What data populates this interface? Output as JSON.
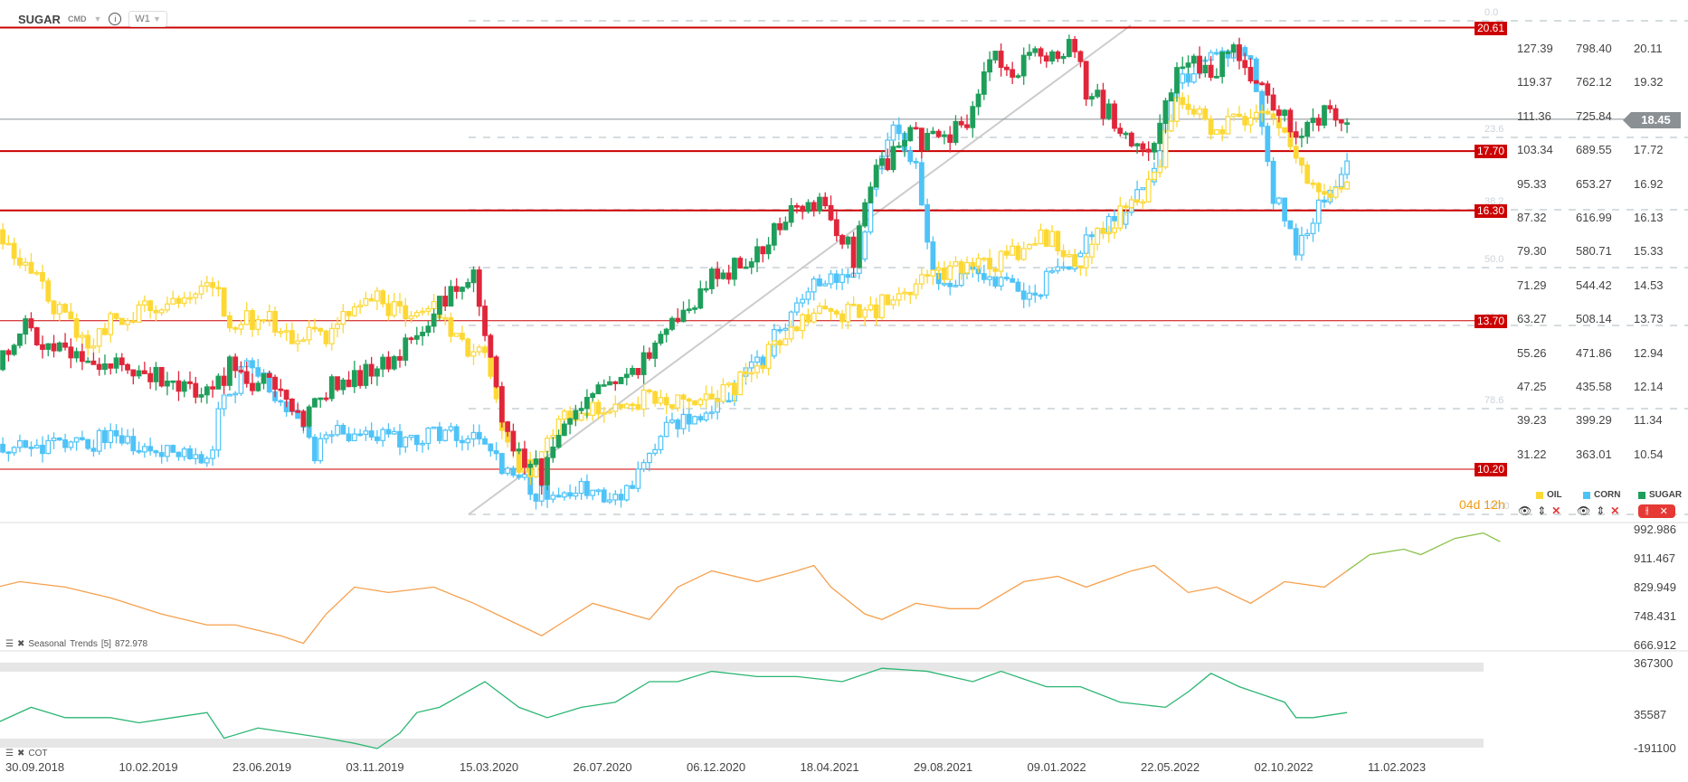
{
  "header": {
    "symbol": "SUGAR",
    "market": "CMD",
    "timeframe": "W1"
  },
  "current_price": "18.45",
  "countdown": "04d 12h",
  "axes": {
    "oil": [
      "127.39",
      "119.37",
      "111.36",
      "103.34",
      "95.33",
      "87.32",
      "79.30",
      "71.29",
      "63.27",
      "55.26",
      "47.25",
      "39.23",
      "31.22"
    ],
    "corn": [
      "798.40",
      "762.12",
      "725.84",
      "689.55",
      "653.27",
      "616.99",
      "580.71",
      "544.42",
      "508.14",
      "471.86",
      "435.58",
      "399.29",
      "363.01"
    ],
    "sugar": [
      "20.11",
      "19.32",
      "18.52",
      "17.72",
      "16.92",
      "16.13",
      "15.33",
      "14.53",
      "13.73",
      "12.94",
      "12.14",
      "11.34",
      "10.54"
    ],
    "seasonal": [
      "992.986",
      "911.467",
      "829.949",
      "748.431",
      "666.912"
    ],
    "cot": [
      "367300",
      "35587",
      "-191100"
    ]
  },
  "hlines": [
    "20.61",
    "17.70",
    "16.30",
    "13.70",
    "10.20"
  ],
  "fib": [
    "0.0",
    "23.6",
    "38.2",
    "50.0",
    "61.8",
    "78.6",
    "100.0"
  ],
  "legend": [
    {
      "name": "OIL",
      "color": "#fdd835"
    },
    {
      "name": "CORN",
      "color": "#4fc3f7"
    },
    {
      "name": "SUGAR",
      "color": "#1e9e5a"
    }
  ],
  "panels": {
    "seasonal_label": "Seasonal",
    "seasonal_name": "Trends",
    "seasonal_period": "[5]",
    "seasonal_value": "872.978",
    "cot_label": "COT"
  },
  "dates": [
    "30.09.2018",
    "10.02.2019",
    "23.06.2019",
    "03.11.2019",
    "15.03.2020",
    "26.07.2020",
    "06.12.2020",
    "18.04.2021",
    "29.08.2021",
    "09.01.2022",
    "22.05.2022",
    "02.10.2022",
    "11.02.2023"
  ],
  "chart_data": {
    "type": "candlestick",
    "title": "SUGAR W1 with OIL and CORN overlay",
    "x_unit": "weeks since 30.09.2018",
    "series": [
      {
        "name": "SUGAR",
        "axis": "sugar",
        "anchors": [
          [
            -8,
            12.64
          ],
          [
            -4,
            13.65
          ],
          [
            4,
            12.9
          ],
          [
            12,
            12.6
          ],
          [
            21,
            12.4
          ],
          [
            29,
            11.9
          ],
          [
            33,
            12.6
          ],
          [
            40,
            12.1
          ],
          [
            46,
            11.25
          ],
          [
            50,
            12.1
          ],
          [
            57,
            12.5
          ],
          [
            65,
            13.1
          ],
          [
            70,
            14.1
          ],
          [
            76,
            14.7
          ],
          [
            79,
            12.9
          ],
          [
            81,
            11.4
          ],
          [
            84,
            10.4
          ],
          [
            88,
            10.1
          ],
          [
            93,
            11.6
          ],
          [
            101,
            12.1
          ],
          [
            107,
            12.9
          ],
          [
            112,
            13.65
          ],
          [
            118,
            14.7
          ],
          [
            126,
            15.2
          ],
          [
            131,
            16.2
          ],
          [
            137,
            16.4
          ],
          [
            143,
            15.2
          ],
          [
            146,
            17.0
          ],
          [
            152,
            18.0
          ],
          [
            158,
            18.0
          ],
          [
            164,
            18.5
          ],
          [
            167,
            20.0
          ],
          [
            171,
            19.5
          ],
          [
            175,
            20.0
          ],
          [
            181,
            20.2
          ],
          [
            184,
            19.2
          ],
          [
            190,
            18.2
          ],
          [
            196,
            17.7
          ],
          [
            200,
            19.7
          ],
          [
            203,
            19.7
          ],
          [
            207,
            19.7
          ],
          [
            211,
            20.0
          ],
          [
            217,
            18.7
          ],
          [
            222,
            18.0
          ],
          [
            226,
            18.5
          ],
          [
            230,
            18.45
          ]
        ]
      },
      {
        "name": "CORN",
        "axis": "corn",
        "anchors": [
          [
            -8,
            366
          ],
          [
            2,
            378
          ],
          [
            12,
            378
          ],
          [
            21,
            372
          ],
          [
            30,
            361
          ],
          [
            31,
            407
          ],
          [
            36,
            459
          ],
          [
            42,
            424
          ],
          [
            48,
            366
          ],
          [
            53,
            389
          ],
          [
            61,
            378
          ],
          [
            69,
            384
          ],
          [
            78,
            378
          ],
          [
            82,
            343
          ],
          [
            88,
            320
          ],
          [
            95,
            326
          ],
          [
            103,
            320
          ],
          [
            107,
            355
          ],
          [
            110,
            389
          ],
          [
            118,
            412
          ],
          [
            126,
            459
          ],
          [
            131,
            505
          ],
          [
            137,
            551
          ],
          [
            143,
            551
          ],
          [
            146,
            643
          ],
          [
            150,
            712
          ],
          [
            154,
            677
          ],
          [
            157,
            551
          ],
          [
            160,
            539
          ],
          [
            164,
            562
          ],
          [
            171,
            539
          ],
          [
            175,
            539
          ],
          [
            183,
            585
          ],
          [
            190,
            620
          ],
          [
            196,
            666
          ],
          [
            200,
            758
          ],
          [
            203,
            770
          ],
          [
            207,
            804
          ],
          [
            213,
            781
          ],
          [
            217,
            643
          ],
          [
            221,
            585
          ],
          [
            224,
            620
          ],
          [
            230,
            677
          ]
        ]
      },
      {
        "name": "OIL",
        "axis": "oil",
        "anchors": [
          [
            -8,
            84.1
          ],
          [
            -4,
            77.8
          ],
          [
            0,
            70.2
          ],
          [
            4,
            62.5
          ],
          [
            8,
            57.4
          ],
          [
            12,
            62.5
          ],
          [
            17,
            65.1
          ],
          [
            23,
            68.9
          ],
          [
            27,
            71.4
          ],
          [
            30,
            72.7
          ],
          [
            33,
            62.5
          ],
          [
            40,
            63.8
          ],
          [
            44,
            60
          ],
          [
            50,
            60
          ],
          [
            55,
            65.1
          ],
          [
            59,
            67.6
          ],
          [
            65,
            65.1
          ],
          [
            70,
            65.1
          ],
          [
            74,
            57.4
          ],
          [
            78,
            54.9
          ],
          [
            82,
            32
          ],
          [
            86,
            26.9
          ],
          [
            91,
            39.6
          ],
          [
            99,
            42.2
          ],
          [
            107,
            44.7
          ],
          [
            114,
            42.2
          ],
          [
            122,
            47.3
          ],
          [
            126,
            52.4
          ],
          [
            129,
            57.4
          ],
          [
            135,
            65.1
          ],
          [
            141,
            65.1
          ],
          [
            145,
            65.1
          ],
          [
            150,
            67.6
          ],
          [
            156,
            72.7
          ],
          [
            162,
            75.3
          ],
          [
            167,
            75.3
          ],
          [
            173,
            80.3
          ],
          [
            177,
            82.9
          ],
          [
            183,
            75.3
          ],
          [
            186,
            82.9
          ],
          [
            192,
            90.5
          ],
          [
            196,
            95.6
          ],
          [
            200,
            116
          ],
          [
            203,
            113.4
          ],
          [
            207,
            108.3
          ],
          [
            211,
            110.9
          ],
          [
            215,
            113.4
          ],
          [
            219,
            105.8
          ],
          [
            222,
            98.1
          ],
          [
            226,
            93
          ],
          [
            230,
            95.6
          ]
        ]
      }
    ],
    "seasonal": {
      "name": "Seasonal Trends [5]",
      "points": [
        [
          -8,
          834
        ],
        [
          -4,
          849
        ],
        [
          4,
          834
        ],
        [
          12,
          804
        ],
        [
          21,
          759
        ],
        [
          29,
          729
        ],
        [
          34,
          729
        ],
        [
          42,
          699
        ],
        [
          46,
          678
        ],
        [
          50,
          759
        ],
        [
          55,
          834
        ],
        [
          61,
          819
        ],
        [
          69,
          834
        ],
        [
          76,
          789
        ],
        [
          82,
          744
        ],
        [
          88,
          699
        ],
        [
          91,
          729
        ],
        [
          97,
          789
        ],
        [
          107,
          744
        ],
        [
          112,
          834
        ],
        [
          118,
          879
        ],
        [
          126,
          849
        ],
        [
          133,
          879
        ],
        [
          136,
          894
        ],
        [
          139,
          834
        ],
        [
          145,
          759
        ],
        [
          148,
          744
        ],
        [
          154,
          789
        ],
        [
          160,
          774
        ],
        [
          165,
          774
        ],
        [
          173,
          849
        ],
        [
          179,
          864
        ],
        [
          184,
          834
        ],
        [
          192,
          879
        ],
        [
          196,
          894
        ],
        [
          202,
          819
        ],
        [
          207,
          834
        ],
        [
          213,
          789
        ],
        [
          219,
          849
        ],
        [
          226,
          834
        ],
        [
          230,
          879
        ],
        [
          234,
          924
        ],
        [
          240,
          939
        ],
        [
          243,
          924
        ],
        [
          249,
          969
        ],
        [
          254,
          984
        ],
        [
          257,
          960
        ]
      ],
      "forecast_from": 230
    },
    "cot": {
      "name": "COT",
      "points": [
        [
          -8,
          -14000
        ],
        [
          -2,
          92000
        ],
        [
          4,
          21000
        ],
        [
          12,
          21000
        ],
        [
          17,
          -14000
        ],
        [
          23,
          21000
        ],
        [
          29,
          56000
        ],
        [
          32,
          -120000
        ],
        [
          38,
          -50000
        ],
        [
          44,
          -85000
        ],
        [
          50,
          -120000
        ],
        [
          55,
          -155000
        ],
        [
          59,
          -191000
        ],
        [
          63,
          -85000
        ],
        [
          66,
          56000
        ],
        [
          70,
          92000
        ],
        [
          78,
          268000
        ],
        [
          84,
          92000
        ],
        [
          89,
          21000
        ],
        [
          95,
          92000
        ],
        [
          101,
          127000
        ],
        [
          107,
          268000
        ],
        [
          112,
          268000
        ],
        [
          118,
          339000
        ],
        [
          126,
          303000
        ],
        [
          133,
          303000
        ],
        [
          141,
          268000
        ],
        [
          148,
          360000
        ],
        [
          156,
          339000
        ],
        [
          164,
          268000
        ],
        [
          169,
          339000
        ],
        [
          177,
          233000
        ],
        [
          183,
          233000
        ],
        [
          190,
          127000
        ],
        [
          198,
          92000
        ],
        [
          202,
          198000
        ],
        [
          206,
          325000
        ],
        [
          211,
          233000
        ],
        [
          219,
          127000
        ],
        [
          221,
          21000
        ],
        [
          224,
          21000
        ],
        [
          230,
          56000
        ]
      ]
    },
    "ylim": {
      "sugar": [
        10.2,
        20.61
      ],
      "corn": [
        363.01,
        798.4
      ],
      "oil": [
        31.22,
        127.39
      ],
      "seasonal": [
        666.912,
        992.986
      ],
      "cot": [
        -191100,
        367300
      ]
    }
  }
}
